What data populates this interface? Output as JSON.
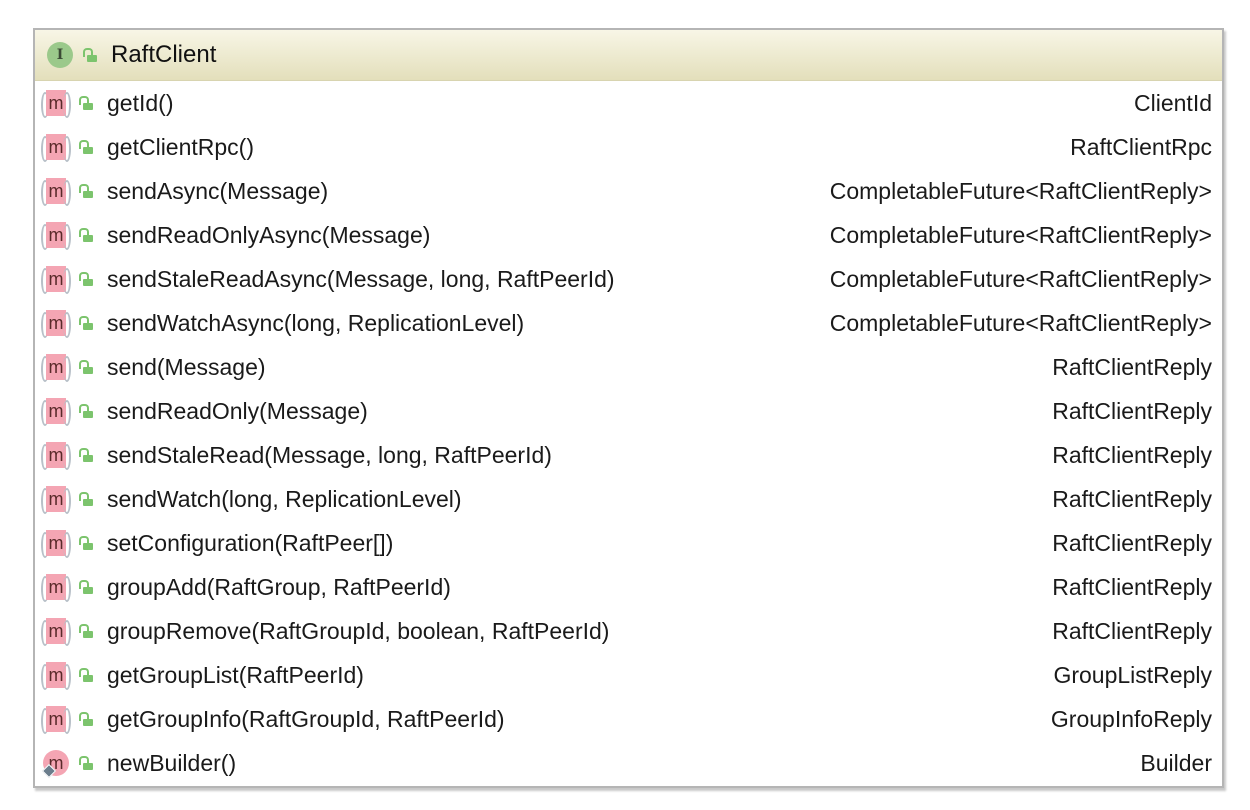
{
  "class": {
    "name": "RaftClient",
    "kind_icon": "interface-icon",
    "kind_letter": "I"
  },
  "methods": [
    {
      "name": "getId()",
      "ret": "ClientId",
      "static": false
    },
    {
      "name": "getClientRpc()",
      "ret": "RaftClientRpc",
      "static": false
    },
    {
      "name": "sendAsync(Message)",
      "ret": "CompletableFuture<RaftClientReply>",
      "static": false
    },
    {
      "name": "sendReadOnlyAsync(Message)",
      "ret": "CompletableFuture<RaftClientReply>",
      "static": false
    },
    {
      "name": "sendStaleReadAsync(Message, long, RaftPeerId)",
      "ret": "CompletableFuture<RaftClientReply>",
      "static": false
    },
    {
      "name": "sendWatchAsync(long, ReplicationLevel)",
      "ret": "CompletableFuture<RaftClientReply>",
      "static": false
    },
    {
      "name": "send(Message)",
      "ret": "RaftClientReply",
      "static": false
    },
    {
      "name": "sendReadOnly(Message)",
      "ret": "RaftClientReply",
      "static": false
    },
    {
      "name": "sendStaleRead(Message, long, RaftPeerId)",
      "ret": "RaftClientReply",
      "static": false
    },
    {
      "name": "sendWatch(long, ReplicationLevel)",
      "ret": "RaftClientReply",
      "static": false
    },
    {
      "name": "setConfiguration(RaftPeer[])",
      "ret": "RaftClientReply",
      "static": false
    },
    {
      "name": "groupAdd(RaftGroup, RaftPeerId)",
      "ret": "RaftClientReply",
      "static": false
    },
    {
      "name": "groupRemove(RaftGroupId, boolean, RaftPeerId)",
      "ret": "RaftClientReply",
      "static": false
    },
    {
      "name": "getGroupList(RaftPeerId)",
      "ret": "GroupListReply",
      "static": false
    },
    {
      "name": "getGroupInfo(RaftGroupId, RaftPeerId)",
      "ret": "GroupInfoReply",
      "static": false
    },
    {
      "name": "newBuilder()",
      "ret": "Builder",
      "static": true
    }
  ],
  "method_letter": "m"
}
